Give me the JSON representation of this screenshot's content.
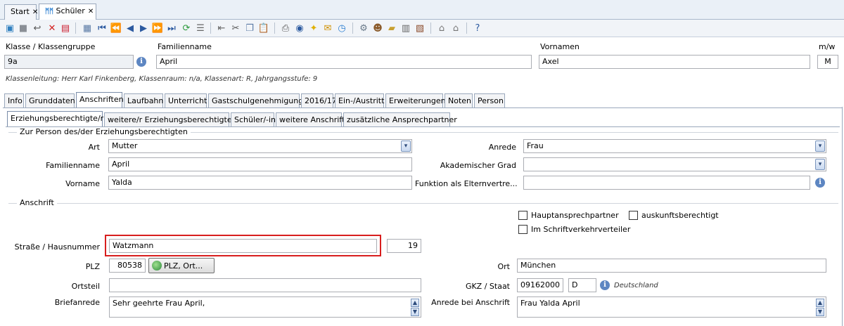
{
  "doc_tabs": [
    {
      "label": "Start",
      "close": "✕"
    },
    {
      "label": "Schüler",
      "close": "✕"
    }
  ],
  "header": {
    "klasse_label": "Klasse / Klassengruppe",
    "klasse_value": "9a",
    "familienname_label": "Familienname",
    "familienname_value": "April",
    "vornamen_label": "Vornamen",
    "vornamen_value": "Axel",
    "mw_label": "m/w",
    "mw_value": "M",
    "info_text": "Klassenleitung: Herr Karl Finkenberg, Klassenraum: n/a, Klassenart: R, Jahrgangsstufe: 9"
  },
  "main_tabs": [
    "Info",
    "Grunddaten",
    "Anschriften",
    "Laufbahn",
    "Unterricht",
    "Gastschulgenehmigung",
    "2016/17",
    "Ein-/Austritt",
    "Erweiterungen",
    "Noten",
    "Person"
  ],
  "sub_tabs": [
    "Erziehungsberechtigte/r",
    "weitere/r Erziehungsberechtigte/r",
    "Schüler/-in",
    "weitere Anschrift",
    "zusätzliche Ansprechpartner"
  ],
  "person_group": {
    "title": "Zur Person des/der Erziehungsberechtigten",
    "art_label": "Art",
    "art_value": "Mutter",
    "familienname_label": "Familienname",
    "familienname_value": "April",
    "vorname_label": "Vorname",
    "vorname_value": "Yalda",
    "anrede_label": "Anrede",
    "anrede_value": "Frau",
    "grad_label": "Akademischer Grad",
    "grad_value": "",
    "funktion_label": "Funktion als Elternvertre...",
    "funktion_value": ""
  },
  "anschrift_group": {
    "title": "Anschrift",
    "cb_haupt": "Hauptansprechpartner",
    "cb_auskunft": "auskunftsberechtigt",
    "cb_verteiler": "Im Schriftverkehrverteiler",
    "strasse_label": "Straße / Hausnummer",
    "strasse_value": "Watzmann",
    "hausnummer_value": "19",
    "plz_label": "PLZ",
    "plz_value": "80538",
    "plz_button": "PLZ, Ort...",
    "ort_label": "Ort",
    "ort_value": "München",
    "ortsteil_label": "Ortsteil",
    "ortsteil_value": "",
    "gkz_label": "GKZ / Staat",
    "gkz_value": "09162000",
    "staat_value": "D",
    "staat_hint": "Deutschland",
    "briefanrede_label": "Briefanrede",
    "briefanrede_value": "Sehr geehrte Frau April,",
    "anrede_anschrift_label": "Anrede bei Anschrift",
    "anrede_anschrift_value": "Frau Yalda April"
  },
  "icons": {
    "info": "i",
    "combo": "▾",
    "up": "▲",
    "down": "▼"
  }
}
